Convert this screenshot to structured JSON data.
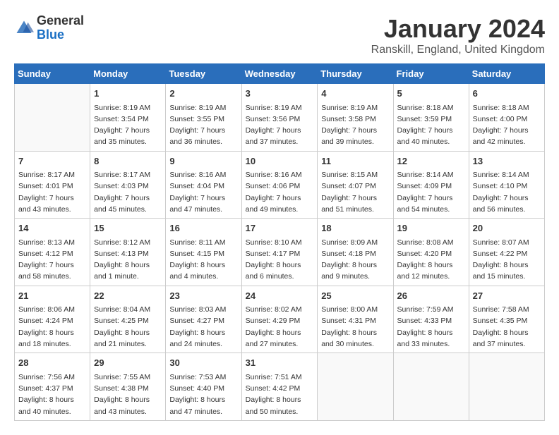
{
  "logo": {
    "general": "General",
    "blue": "Blue"
  },
  "header": {
    "month": "January 2024",
    "location": "Ranskill, England, United Kingdom"
  },
  "columns": [
    "Sunday",
    "Monday",
    "Tuesday",
    "Wednesday",
    "Thursday",
    "Friday",
    "Saturday"
  ],
  "weeks": [
    [
      {
        "day": "",
        "info": ""
      },
      {
        "day": "1",
        "info": "Sunrise: 8:19 AM\nSunset: 3:54 PM\nDaylight: 7 hours\nand 35 minutes."
      },
      {
        "day": "2",
        "info": "Sunrise: 8:19 AM\nSunset: 3:55 PM\nDaylight: 7 hours\nand 36 minutes."
      },
      {
        "day": "3",
        "info": "Sunrise: 8:19 AM\nSunset: 3:56 PM\nDaylight: 7 hours\nand 37 minutes."
      },
      {
        "day": "4",
        "info": "Sunrise: 8:19 AM\nSunset: 3:58 PM\nDaylight: 7 hours\nand 39 minutes."
      },
      {
        "day": "5",
        "info": "Sunrise: 8:18 AM\nSunset: 3:59 PM\nDaylight: 7 hours\nand 40 minutes."
      },
      {
        "day": "6",
        "info": "Sunrise: 8:18 AM\nSunset: 4:00 PM\nDaylight: 7 hours\nand 42 minutes."
      }
    ],
    [
      {
        "day": "7",
        "info": "Sunrise: 8:17 AM\nSunset: 4:01 PM\nDaylight: 7 hours\nand 43 minutes."
      },
      {
        "day": "8",
        "info": "Sunrise: 8:17 AM\nSunset: 4:03 PM\nDaylight: 7 hours\nand 45 minutes."
      },
      {
        "day": "9",
        "info": "Sunrise: 8:16 AM\nSunset: 4:04 PM\nDaylight: 7 hours\nand 47 minutes."
      },
      {
        "day": "10",
        "info": "Sunrise: 8:16 AM\nSunset: 4:06 PM\nDaylight: 7 hours\nand 49 minutes."
      },
      {
        "day": "11",
        "info": "Sunrise: 8:15 AM\nSunset: 4:07 PM\nDaylight: 7 hours\nand 51 minutes."
      },
      {
        "day": "12",
        "info": "Sunrise: 8:14 AM\nSunset: 4:09 PM\nDaylight: 7 hours\nand 54 minutes."
      },
      {
        "day": "13",
        "info": "Sunrise: 8:14 AM\nSunset: 4:10 PM\nDaylight: 7 hours\nand 56 minutes."
      }
    ],
    [
      {
        "day": "14",
        "info": "Sunrise: 8:13 AM\nSunset: 4:12 PM\nDaylight: 7 hours\nand 58 minutes."
      },
      {
        "day": "15",
        "info": "Sunrise: 8:12 AM\nSunset: 4:13 PM\nDaylight: 8 hours\nand 1 minute."
      },
      {
        "day": "16",
        "info": "Sunrise: 8:11 AM\nSunset: 4:15 PM\nDaylight: 8 hours\nand 4 minutes."
      },
      {
        "day": "17",
        "info": "Sunrise: 8:10 AM\nSunset: 4:17 PM\nDaylight: 8 hours\nand 6 minutes."
      },
      {
        "day": "18",
        "info": "Sunrise: 8:09 AM\nSunset: 4:18 PM\nDaylight: 8 hours\nand 9 minutes."
      },
      {
        "day": "19",
        "info": "Sunrise: 8:08 AM\nSunset: 4:20 PM\nDaylight: 8 hours\nand 12 minutes."
      },
      {
        "day": "20",
        "info": "Sunrise: 8:07 AM\nSunset: 4:22 PM\nDaylight: 8 hours\nand 15 minutes."
      }
    ],
    [
      {
        "day": "21",
        "info": "Sunrise: 8:06 AM\nSunset: 4:24 PM\nDaylight: 8 hours\nand 18 minutes."
      },
      {
        "day": "22",
        "info": "Sunrise: 8:04 AM\nSunset: 4:25 PM\nDaylight: 8 hours\nand 21 minutes."
      },
      {
        "day": "23",
        "info": "Sunrise: 8:03 AM\nSunset: 4:27 PM\nDaylight: 8 hours\nand 24 minutes."
      },
      {
        "day": "24",
        "info": "Sunrise: 8:02 AM\nSunset: 4:29 PM\nDaylight: 8 hours\nand 27 minutes."
      },
      {
        "day": "25",
        "info": "Sunrise: 8:00 AM\nSunset: 4:31 PM\nDaylight: 8 hours\nand 30 minutes."
      },
      {
        "day": "26",
        "info": "Sunrise: 7:59 AM\nSunset: 4:33 PM\nDaylight: 8 hours\nand 33 minutes."
      },
      {
        "day": "27",
        "info": "Sunrise: 7:58 AM\nSunset: 4:35 PM\nDaylight: 8 hours\nand 37 minutes."
      }
    ],
    [
      {
        "day": "28",
        "info": "Sunrise: 7:56 AM\nSunset: 4:37 PM\nDaylight: 8 hours\nand 40 minutes."
      },
      {
        "day": "29",
        "info": "Sunrise: 7:55 AM\nSunset: 4:38 PM\nDaylight: 8 hours\nand 43 minutes."
      },
      {
        "day": "30",
        "info": "Sunrise: 7:53 AM\nSunset: 4:40 PM\nDaylight: 8 hours\nand 47 minutes."
      },
      {
        "day": "31",
        "info": "Sunrise: 7:51 AM\nSunset: 4:42 PM\nDaylight: 8 hours\nand 50 minutes."
      },
      {
        "day": "",
        "info": ""
      },
      {
        "day": "",
        "info": ""
      },
      {
        "day": "",
        "info": ""
      }
    ]
  ]
}
